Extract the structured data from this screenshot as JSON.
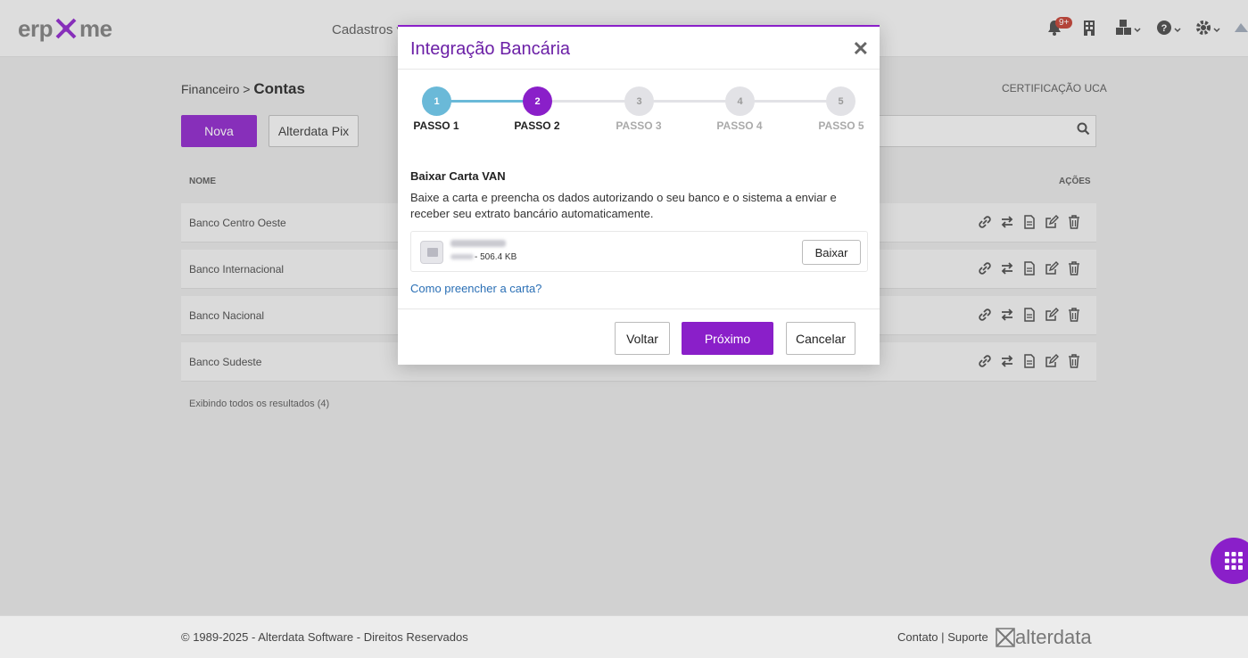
{
  "topbar": {
    "logo_text_left": "erp",
    "logo_text_right": "me",
    "nav_cadastros": "Cadastros",
    "notification_badge": "9+"
  },
  "page": {
    "breadcrumb_parent": "Financeiro",
    "breadcrumb_sep": ">",
    "breadcrumb_current": "Contas",
    "certification": "CERTIFICAÇÃO UCA",
    "btn_nova": "Nova",
    "btn_pix": "Alterdata Pix",
    "col_nome": "NOME",
    "col_acoes": "AÇÕES",
    "rows": [
      {
        "name": "Banco Centro Oeste"
      },
      {
        "name": "Banco Internacional"
      },
      {
        "name": "Banco Nacional"
      },
      {
        "name": "Banco Sudeste"
      }
    ],
    "result_count": "Exibindo todos os resultados (4)"
  },
  "footer": {
    "copyright": "© 1989-2025 - Alterdata Software - Direitos Reservados",
    "contato": "Contato",
    "sep": "|",
    "suporte": "Suporte",
    "brand": "alterdata"
  },
  "modal": {
    "title": "Integração Bancária",
    "close": "✕",
    "steps": [
      {
        "num": "1",
        "label": "PASSO 1",
        "state": "done"
      },
      {
        "num": "2",
        "label": "PASSO 2",
        "state": "active"
      },
      {
        "num": "3",
        "label": "PASSO 3",
        "state": "pending"
      },
      {
        "num": "4",
        "label": "PASSO 4",
        "state": "pending"
      },
      {
        "num": "5",
        "label": "PASSO 5",
        "state": "pending"
      }
    ],
    "section_title": "Baixar Carta VAN",
    "section_text": "Baixe a carta e preencha os dados autorizando o seu banco e o sistema a enviar e receber seu extrato bancário automaticamente.",
    "file_size": "- 506.4 KB",
    "btn_baixar": "Baixar",
    "help_link": "Como preencher a carta?",
    "btn_voltar": "Voltar",
    "btn_proximo": "Próximo",
    "btn_cancelar": "Cancelar"
  },
  "colors": {
    "brand_purple": "#8a1fc9",
    "step_done": "#6ab9d8",
    "step_pending": "#e2e2e6",
    "link": "#2a6fb5"
  }
}
